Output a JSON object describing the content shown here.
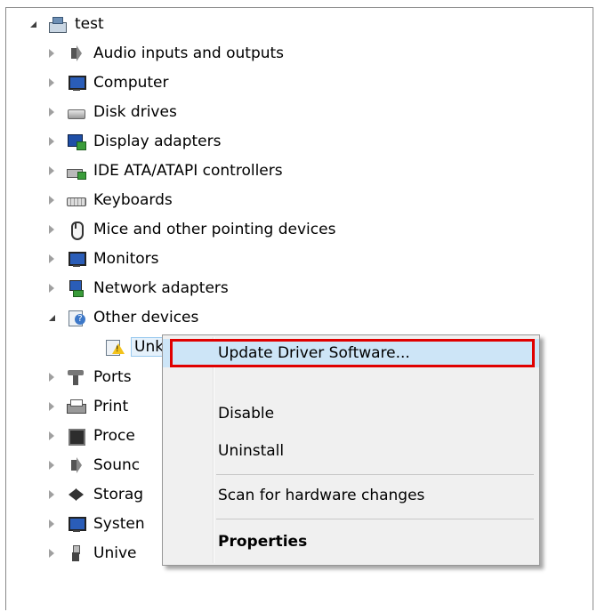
{
  "tree": {
    "root": {
      "label": "test",
      "icon": "computer-root-icon"
    },
    "items": [
      {
        "label": "Audio inputs and outputs",
        "icon": "speaker-icon"
      },
      {
        "label": "Computer",
        "icon": "monitor-icon"
      },
      {
        "label": "Disk drives",
        "icon": "disk-drive-icon"
      },
      {
        "label": "Display adapters",
        "icon": "display-adapter-icon"
      },
      {
        "label": "IDE ATA/ATAPI controllers",
        "icon": "ide-controller-icon"
      },
      {
        "label": "Keyboards",
        "icon": "keyboard-icon"
      },
      {
        "label": "Mice and other pointing devices",
        "icon": "mouse-icon"
      },
      {
        "label": "Monitors",
        "icon": "monitor-icon"
      },
      {
        "label": "Network adapters",
        "icon": "network-adapter-icon"
      },
      {
        "label": "Other devices",
        "icon": "other-devices-icon"
      },
      {
        "label": "Unknown device",
        "icon": "unknown-device-warning-icon"
      },
      {
        "label": "Ports",
        "icon": "port-icon"
      },
      {
        "label": "Print",
        "icon": "printer-icon"
      },
      {
        "label": "Proce",
        "icon": "processor-icon"
      },
      {
        "label": "Sounc",
        "icon": "speaker-icon"
      },
      {
        "label": "Storag",
        "icon": "storage-icon"
      },
      {
        "label": "Systen",
        "icon": "system-monitor-icon"
      },
      {
        "label": "Unive",
        "icon": "usb-icon"
      }
    ]
  },
  "context_menu": {
    "items": [
      {
        "label": "Update Driver Software..."
      },
      {
        "label": "Disable"
      },
      {
        "label": "Uninstall"
      },
      {
        "label": "Scan for hardware changes"
      },
      {
        "label": "Properties"
      }
    ]
  }
}
